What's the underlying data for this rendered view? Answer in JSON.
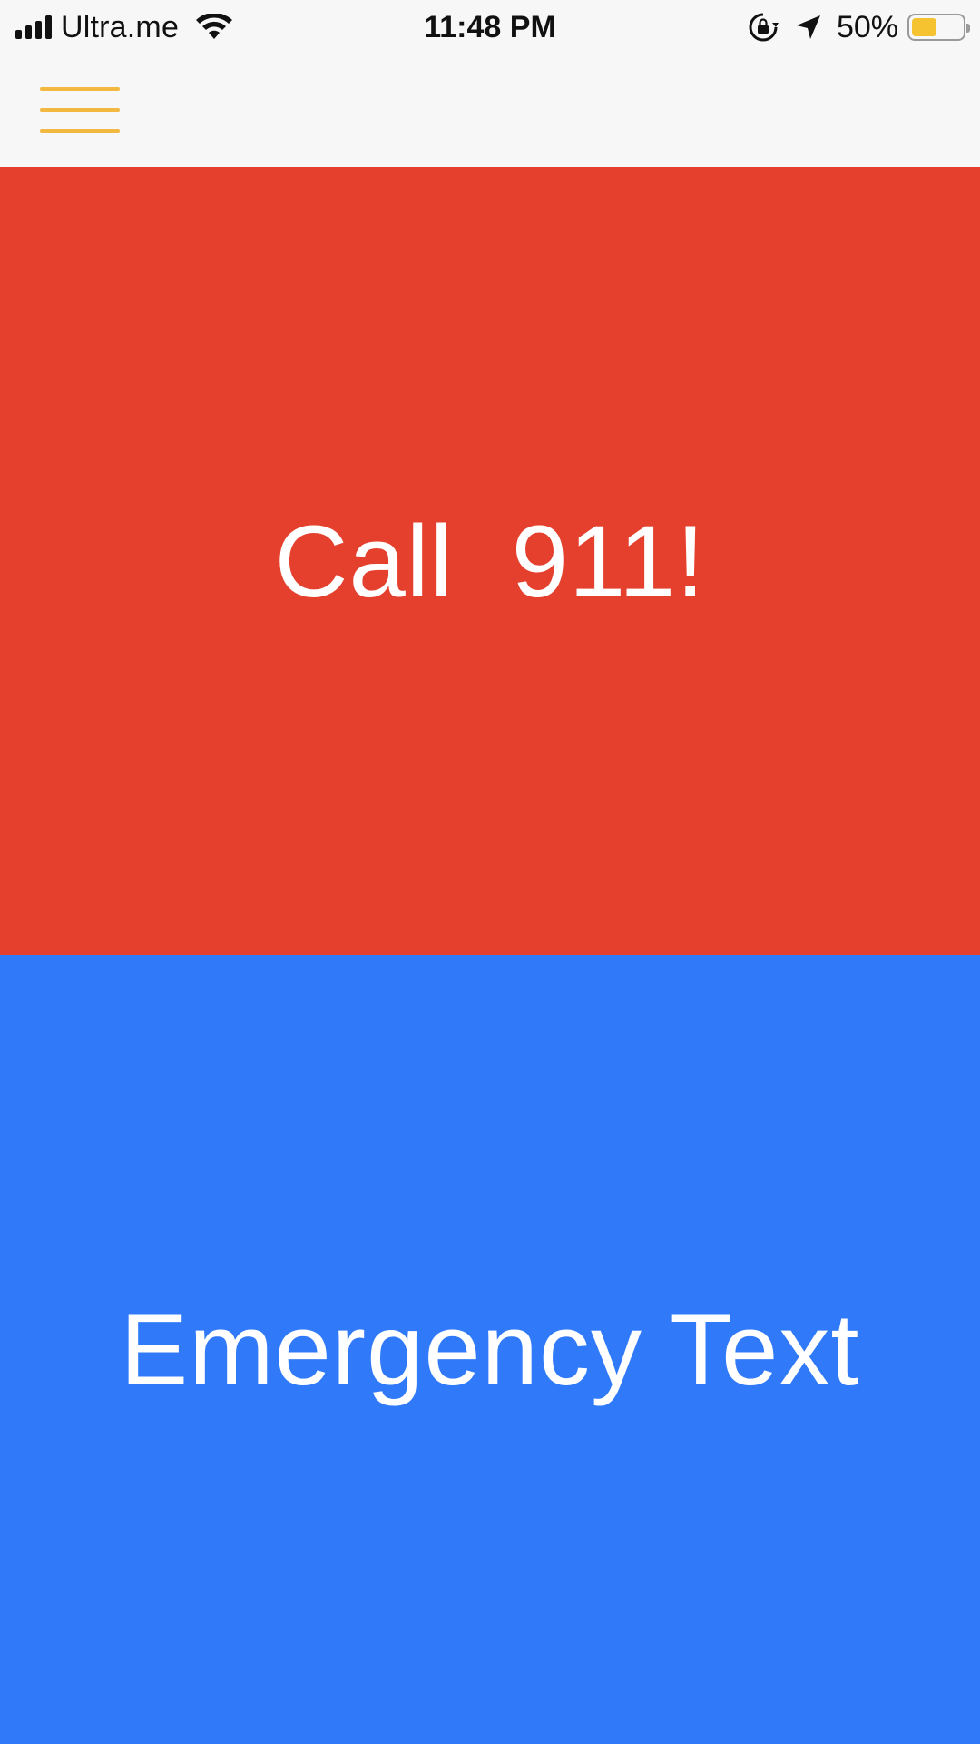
{
  "status_bar": {
    "carrier": "Ultra.me",
    "time": "11:48 PM",
    "battery_percent": "50%",
    "battery_level": 0.5,
    "signal_strength": 4,
    "icons": [
      "signal-icon",
      "wifi-icon",
      "lock-rotation-icon",
      "location-icon",
      "battery-icon"
    ]
  },
  "nav": {
    "menu_icon": "hamburger-menu-icon",
    "accent_color": "#f3b83f"
  },
  "actions": {
    "call": {
      "label": "Call  911!",
      "color": "#e5402d"
    },
    "text": {
      "label": "Emergency Text",
      "color": "#307afa"
    }
  }
}
